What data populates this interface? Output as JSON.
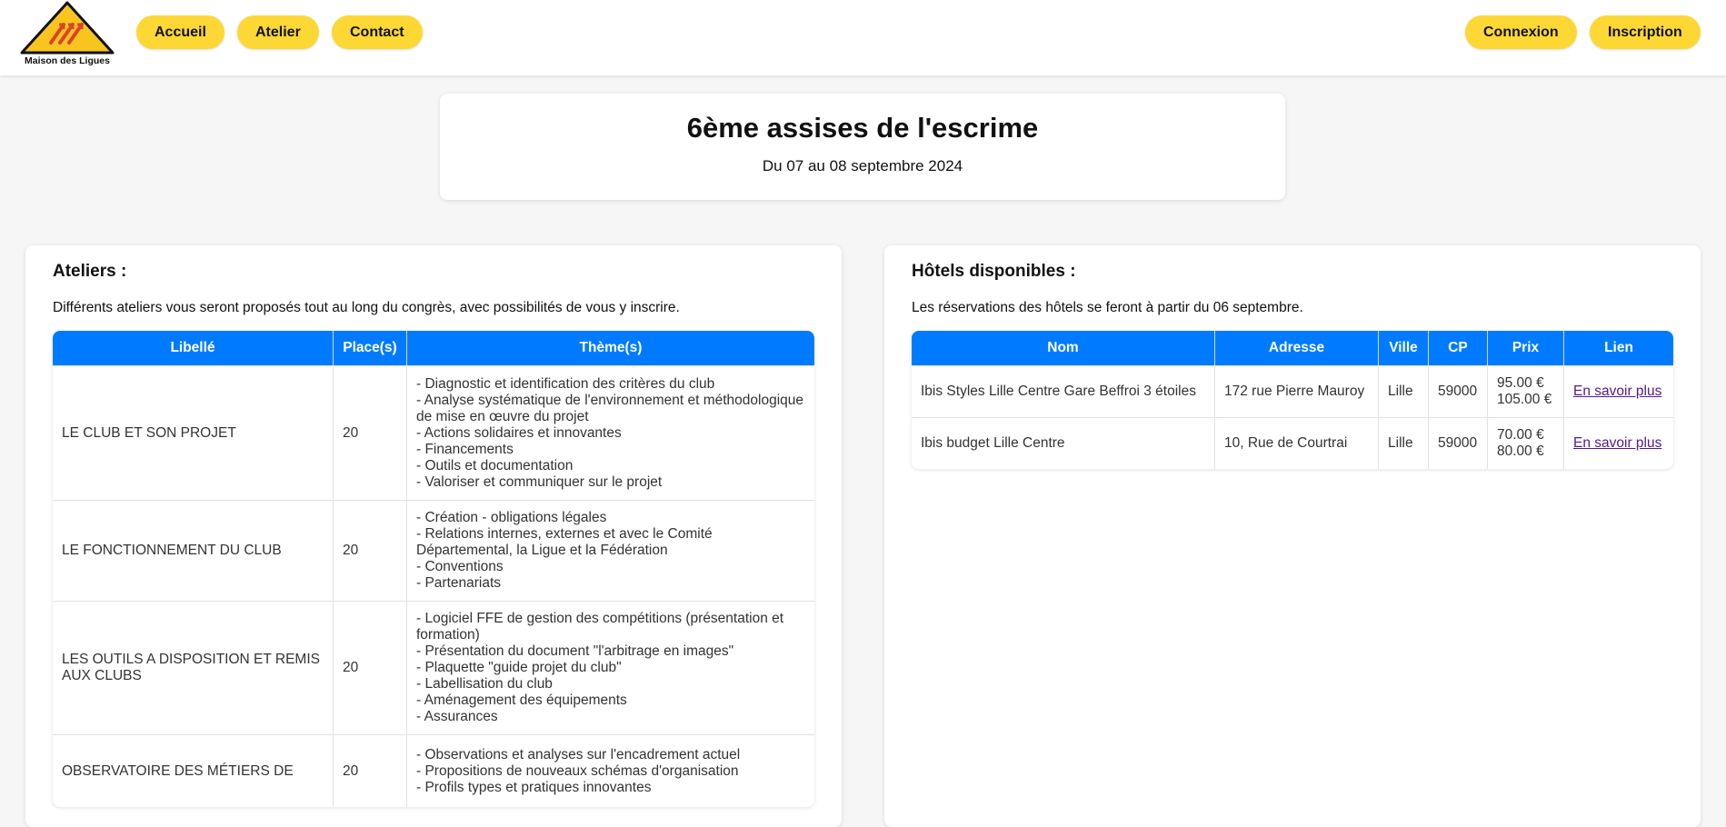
{
  "header": {
    "logo_text": "Maison des Ligues",
    "nav": [
      "Accueil",
      "Atelier",
      "Contact"
    ],
    "auth": [
      "Connexion",
      "Inscription"
    ]
  },
  "event": {
    "title": "6ème assises de l'escrime",
    "dates": "Du 07 au 08 septembre 2024"
  },
  "ateliers": {
    "title": "Ateliers :",
    "description": "Différents ateliers vous seront proposés tout au long du congrès, avec possibilités de vous y inscrire.",
    "columns": [
      "Libellé",
      "Place(s)",
      "Thème(s)"
    ],
    "rows": [
      {
        "libelle": "LE CLUB ET SON PROJET",
        "places": "20",
        "themes": "- Diagnostic et identification des critères du club\n- Analyse systématique de l'environnement et méthodologique de mise en œuvre du projet\n- Actions solidaires et innovantes\n- Financements\n- Outils et documentation\n- Valoriser et communiquer sur le projet"
      },
      {
        "libelle": "LE FONCTIONNEMENT DU CLUB",
        "places": "20",
        "themes": "- Création - obligations légales\n- Relations internes, externes et avec le Comité Départemental, la Ligue et la Fédération\n- Conventions\n- Partenariats"
      },
      {
        "libelle": "LES OUTILS A DISPOSITION ET REMIS AUX CLUBS",
        "places": "20",
        "themes": "- Logiciel FFE de gestion des compétitions (présentation et formation)\n- Présentation du document \"l'arbitrage en images\"\n- Plaquette \"guide projet du club\"\n- Labellisation du club\n- Aménagement des équipements\n- Assurances"
      },
      {
        "libelle": "OBSERVATOIRE DES MÉTIERS DE",
        "places": "20",
        "themes": "- Observations et analyses sur l'encadrement actuel\n- Propositions de nouveaux schémas d'organisation\n- Profils types et pratiques innovantes"
      }
    ]
  },
  "hotels": {
    "title": "Hôtels disponibles :",
    "description": "Les réservations des hôtels se feront à partir du 06 septembre.",
    "columns": [
      "Nom",
      "Adresse",
      "Ville",
      "CP",
      "Prix",
      "Lien"
    ],
    "rows": [
      {
        "nom": "Ibis Styles Lille Centre Gare Beffroi 3 étoiles",
        "adresse": "172 rue Pierre Mauroy",
        "ville": "Lille",
        "cp": "59000",
        "prix": "95.00 €\n105.00 €",
        "lien": "En savoir plus"
      },
      {
        "nom": "Ibis budget Lille Centre",
        "adresse": "10, Rue de Courtrai",
        "ville": "Lille",
        "cp": "59000",
        "prix": "70.00 €\n80.00 €",
        "lien": "En savoir plus"
      }
    ]
  },
  "colors": {
    "accent_yellow": "#fdd835",
    "table_header_blue": "#007bff",
    "link_purple": "#551a8b",
    "logo_triangle": "#f7c51e",
    "logo_arrows": "#d9452b"
  },
  "icons": [
    "logo-triangle-icon"
  ]
}
